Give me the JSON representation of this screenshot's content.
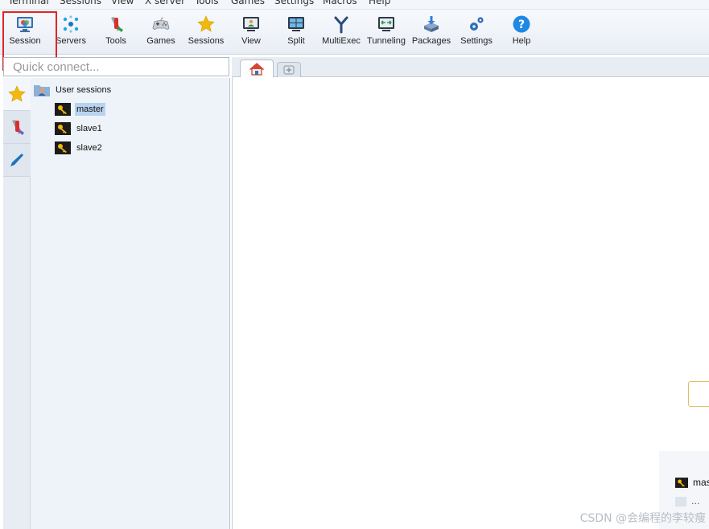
{
  "menu": [
    "Terminal",
    "Sessions",
    "View",
    "X server",
    "Tools",
    "Games",
    "Settings",
    "Macros",
    "Help"
  ],
  "toolbar": [
    {
      "label": "Session",
      "icon": "session-icon"
    },
    {
      "label": "Servers",
      "icon": "servers-icon"
    },
    {
      "label": "Tools",
      "icon": "tools-icon"
    },
    {
      "label": "Games",
      "icon": "games-icon"
    },
    {
      "label": "Sessions",
      "icon": "star-icon"
    },
    {
      "label": "View",
      "icon": "view-icon"
    },
    {
      "label": "Split",
      "icon": "split-icon"
    },
    {
      "label": "MultiExec",
      "icon": "multiexec-icon"
    },
    {
      "label": "Tunneling",
      "icon": "tunneling-icon"
    },
    {
      "label": "Packages",
      "icon": "packages-icon"
    },
    {
      "label": "Settings",
      "icon": "gears-icon"
    },
    {
      "label": "Help",
      "icon": "help-icon"
    }
  ],
  "quick_connect": {
    "placeholder": "Quick connect..."
  },
  "tree": {
    "root": "User sessions",
    "items": [
      "master",
      "slave1",
      "slave2"
    ],
    "selected": "master"
  },
  "recent": {
    "item": "mas",
    "more": "..."
  },
  "watermark": "CSDN @会编程的李较瘦",
  "colors": {
    "highlight": "#e02626",
    "selection": "#b7d3ee",
    "accent": "#1e73be"
  }
}
